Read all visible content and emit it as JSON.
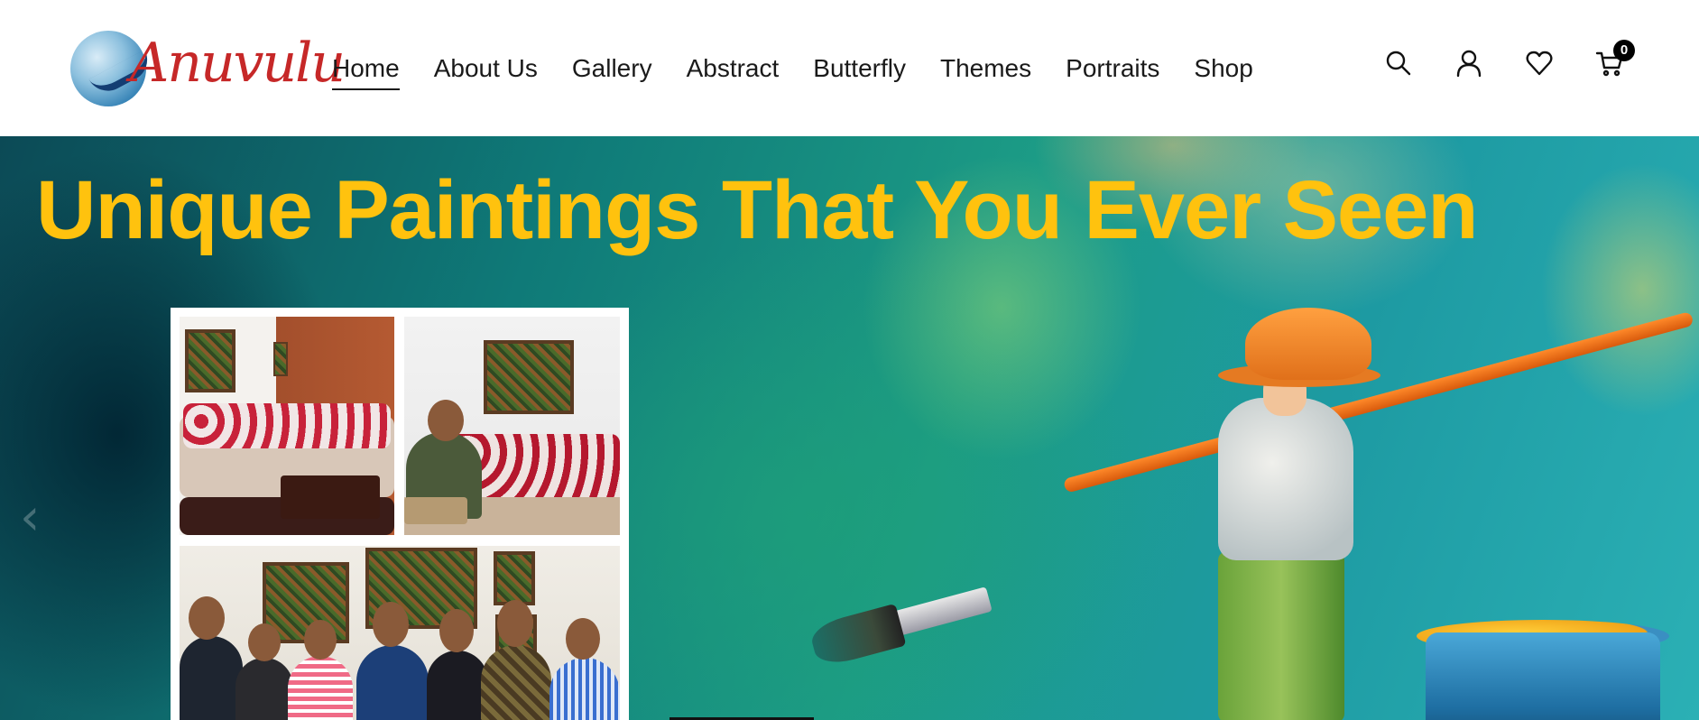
{
  "logo": {
    "text": "Anuvulu",
    "icon": "brush-stroke-logo"
  },
  "nav": {
    "items": [
      {
        "label": "Home",
        "active": true
      },
      {
        "label": "About Us",
        "active": false
      },
      {
        "label": "Gallery",
        "active": false
      },
      {
        "label": "Abstract",
        "active": false
      },
      {
        "label": "Butterfly",
        "active": false
      },
      {
        "label": "Themes",
        "active": false
      },
      {
        "label": "Portraits",
        "active": false
      },
      {
        "label": "Shop",
        "active": false
      }
    ]
  },
  "header_icons": {
    "search": "search-icon",
    "account": "user-icon",
    "wishlist": "heart-icon",
    "cart": "cart-icon",
    "cart_count": "0"
  },
  "hero": {
    "title": "Unique Paintings That You Ever Seen",
    "prev_arrow": "‹"
  },
  "colors": {
    "accent": "#ffc20e",
    "header_bg": "#ffffff",
    "nav_text": "#1a1a1a",
    "logo_red": "#c62828",
    "hero_teal": "#1c9c86"
  }
}
